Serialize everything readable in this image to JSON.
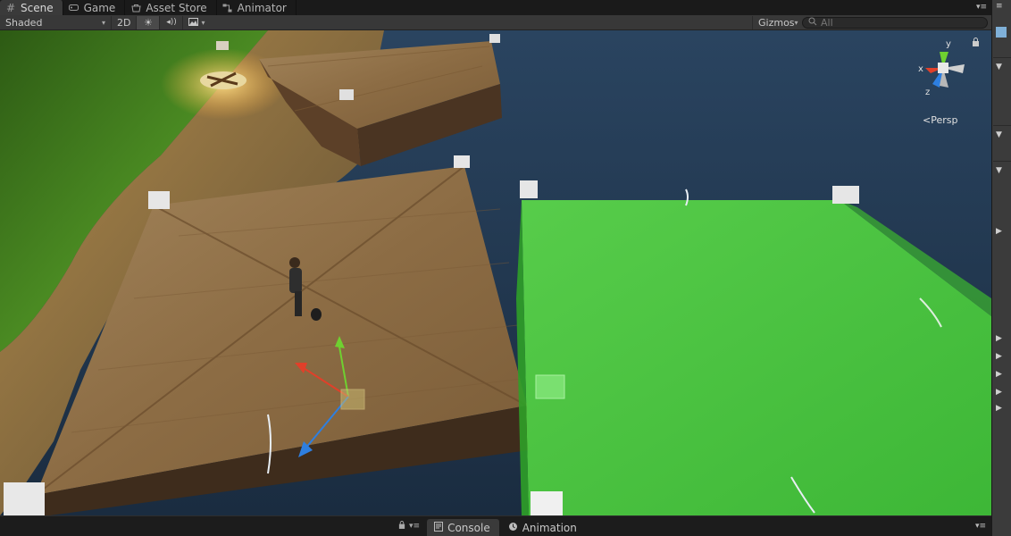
{
  "tabs": {
    "scene": "Scene",
    "game": "Game",
    "asset_store": "Asset Store",
    "animator": "Animator"
  },
  "toolbar": {
    "shading_mode": "Shaded",
    "mode_2d": "2D",
    "gizmos": "Gizmos",
    "search_placeholder": "All"
  },
  "scene_view": {
    "projection_label": "Persp",
    "axis_labels": {
      "y": "y",
      "x": "x",
      "z": "z"
    }
  },
  "bottom_tabs": {
    "console": "Console",
    "animation": "Animation"
  },
  "icons": [
    "scene-hash-icon",
    "game-icon",
    "asset-store-icon",
    "animator-icon",
    "sun-icon",
    "audio-icon",
    "image-icon",
    "search-icon",
    "lock-icon",
    "console-icon",
    "animation-icon",
    "menu-icon"
  ],
  "colors": {
    "selected_volume": "#4cc93f",
    "water": "#22384f",
    "grass": "#3f7a1c",
    "wood": "#8a6a40",
    "gizmo_y": "#6fd030",
    "gizmo_x": "#e0402a",
    "gizmo_z": "#2e7fe0"
  }
}
